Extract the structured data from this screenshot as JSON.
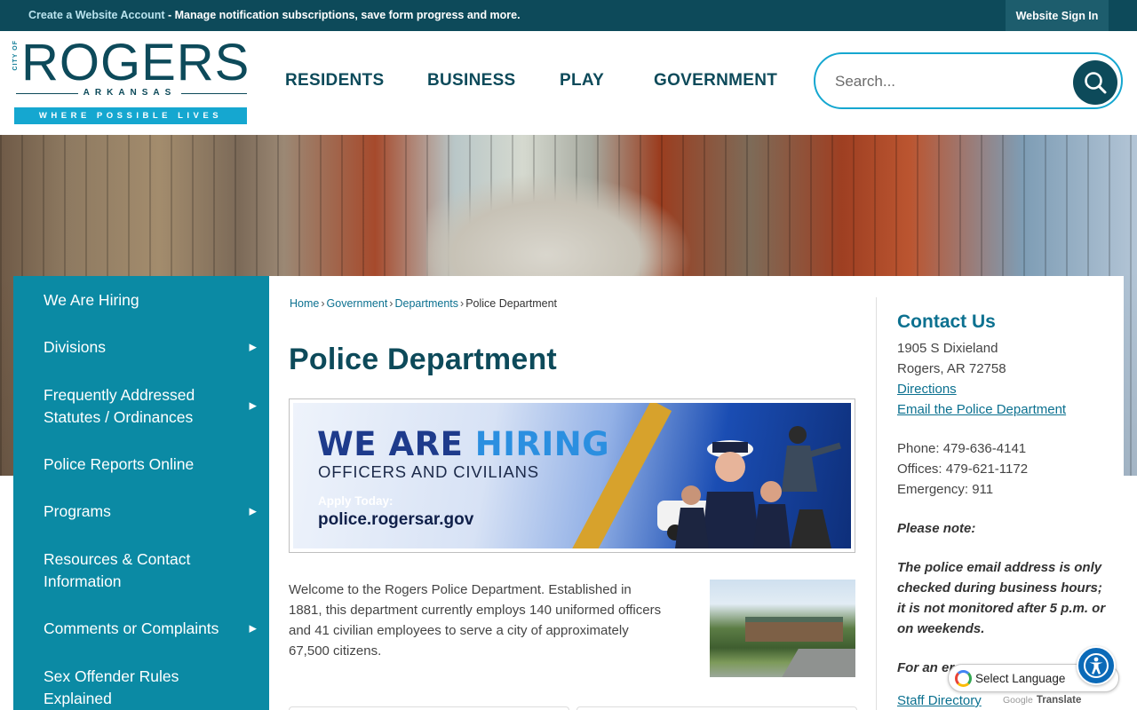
{
  "topbar": {
    "account_link": "Create a Website Account",
    "account_text": " - Manage notification subscriptions, save form progress and more.",
    "sign_in": "Website Sign In"
  },
  "logo": {
    "city": "CITY OF",
    "name": "ROGERS",
    "state": "ARKANSAS",
    "tagline": "WHERE POSSIBLE LIVES"
  },
  "nav": {
    "items": [
      "RESIDENTS",
      "BUSINESS",
      "PLAY",
      "GOVERNMENT"
    ]
  },
  "search": {
    "placeholder": "Search..."
  },
  "sidebar": {
    "items": [
      {
        "label": "We Are Hiring",
        "has_arrow": false
      },
      {
        "label": "Divisions",
        "has_arrow": true
      },
      {
        "label": "Frequently Addressed Statutes / Ordinances",
        "has_arrow": true
      },
      {
        "label": "Police Reports Online",
        "has_arrow": false
      },
      {
        "label": "Programs",
        "has_arrow": true
      },
      {
        "label": "Resources & Contact Information",
        "has_arrow": false
      },
      {
        "label": "Comments or Complaints",
        "has_arrow": true
      },
      {
        "label": "Sex Offender Rules Explained",
        "has_arrow": false
      }
    ]
  },
  "breadcrumb": {
    "items": [
      "Home",
      "Government",
      "Departments"
    ],
    "current": "Police Department"
  },
  "page": {
    "title": "Police Department",
    "intro": "Welcome to the Rogers Police Department. Established in 1881, this department currently employs 140 uniformed officers and 41 civilian employees to serve a city of approximately 67,500 citizens."
  },
  "hiring_banner": {
    "headline_a": "WE ARE ",
    "headline_b": "HIRING",
    "sub": "OFFICERS AND CIVILIANS",
    "apply": "Apply Today:",
    "url": "police.rogersar.gov"
  },
  "contact": {
    "title": "Contact Us",
    "address1": "1905 S Dixieland",
    "address2": "Rogers, AR 72758",
    "directions": "Directions",
    "email": "Email the Police Department",
    "phone": "Phone: 479-636-4141",
    "offices": "Offices: 479-621-1172",
    "emergency": "Emergency: 911",
    "note_label": "Please note:",
    "note_text": "The police email address is only checked during business hours; it is not monitored after 5 p.m. or on weekends.",
    "more_text": "For an er",
    "staff": "Staff Directory"
  },
  "translate": {
    "label": "Select Language",
    "powered_by": "Google",
    "translate": "Translate"
  },
  "colors": {
    "dark_teal": "#0d4a5a",
    "sidebar_teal": "#0b8aa4",
    "accent_blue": "#15a7d0",
    "link": "#0c7190"
  }
}
